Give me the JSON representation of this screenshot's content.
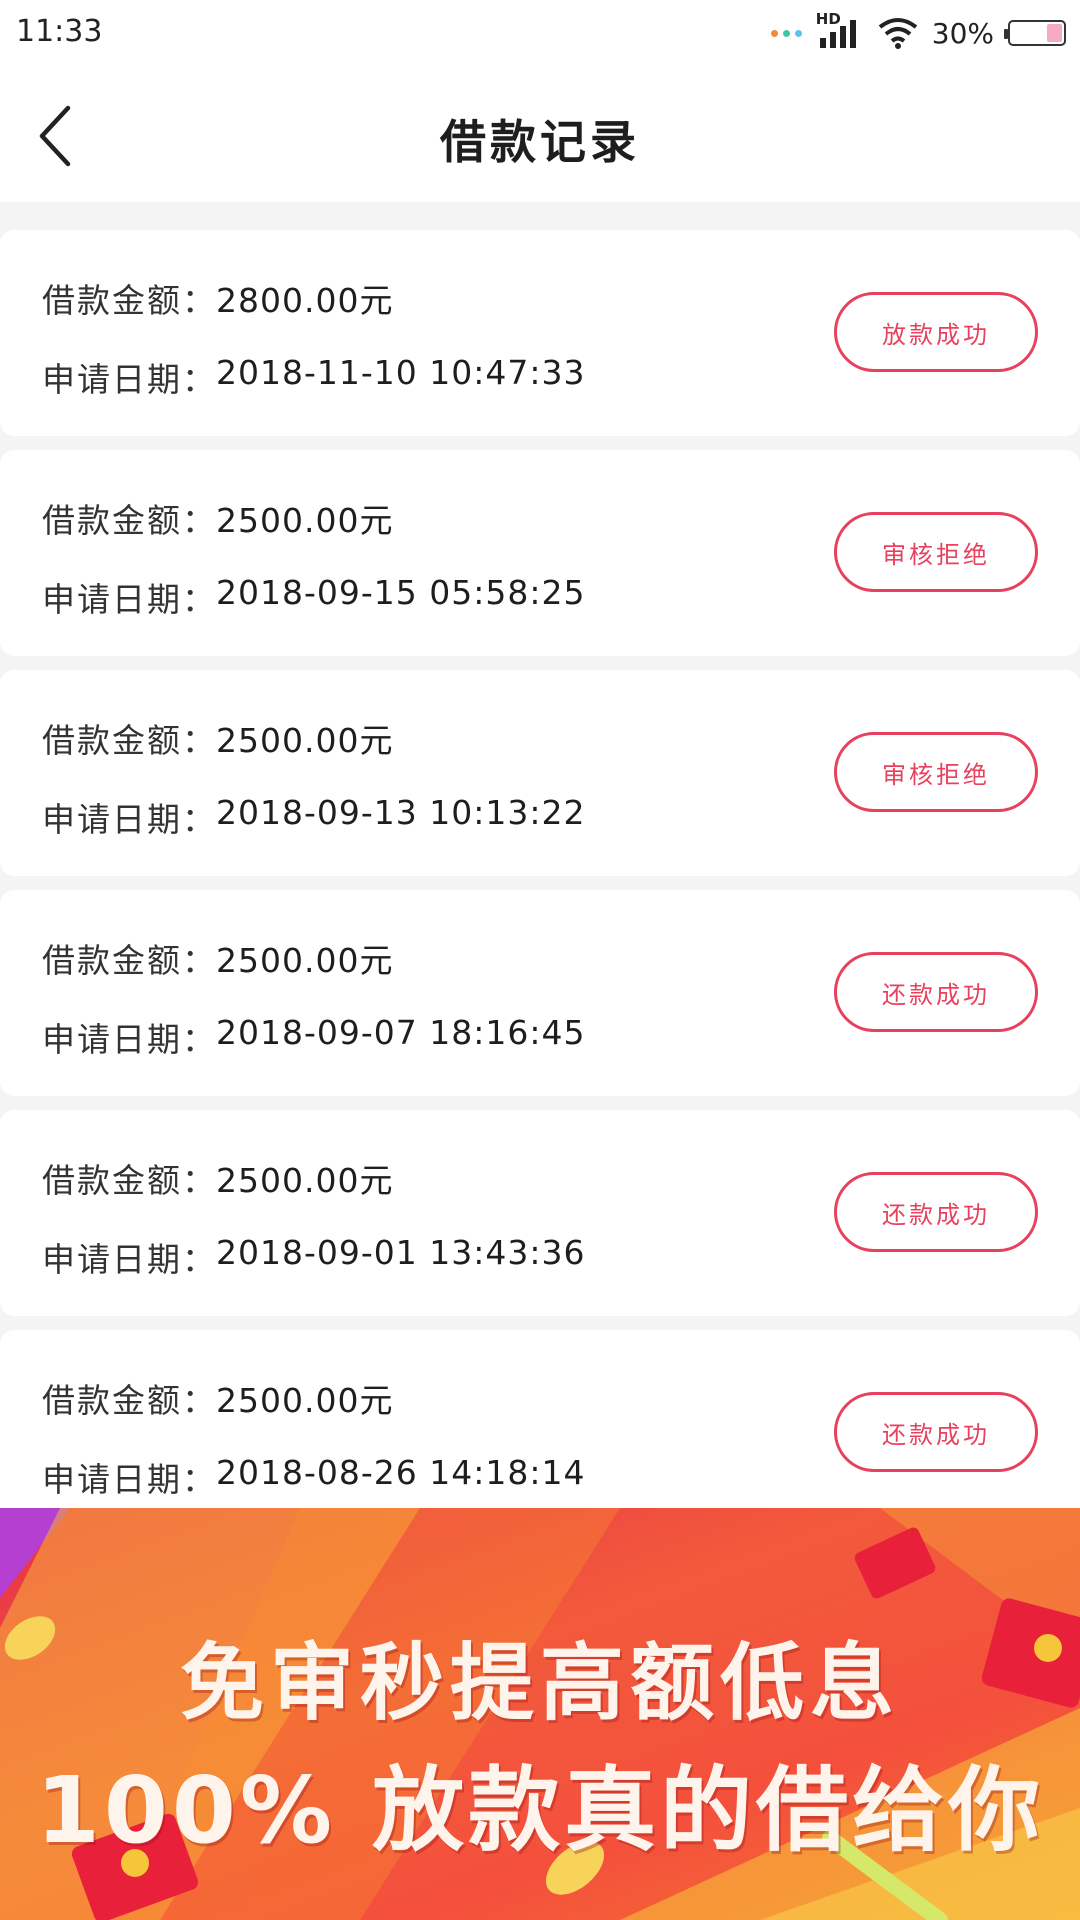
{
  "status_bar": {
    "time": "11:33",
    "network_label": "HD",
    "battery_text": "30%",
    "battery_level": 0.3,
    "dot_colors": [
      "#f08a3a",
      "#3ec9a0",
      "#58c4f0"
    ]
  },
  "header": {
    "title": "借款记录",
    "back_icon": "chevron-left-icon"
  },
  "labels": {
    "amount": "借款金额：",
    "date": "申请日期："
  },
  "records": [
    {
      "amount": "2800.00元",
      "date": "2018-11-10 10:47:33",
      "status": "放款成功"
    },
    {
      "amount": "2500.00元",
      "date": "2018-09-15 05:58:25",
      "status": "审核拒绝"
    },
    {
      "amount": "2500.00元",
      "date": "2018-09-13 10:13:22",
      "status": "审核拒绝"
    },
    {
      "amount": "2500.00元",
      "date": "2018-09-07 18:16:45",
      "status": "还款成功"
    },
    {
      "amount": "2500.00元",
      "date": "2018-09-01 13:43:36",
      "status": "还款成功"
    },
    {
      "amount": "2500.00元",
      "date": "2018-08-26 14:18:14",
      "status": "还款成功"
    }
  ],
  "banner": {
    "line1": "免审秒提高额低息",
    "line2": "100% 放款真的借给你"
  },
  "colors": {
    "accent": "#e8415e",
    "banner_red": "#f25a3b"
  }
}
